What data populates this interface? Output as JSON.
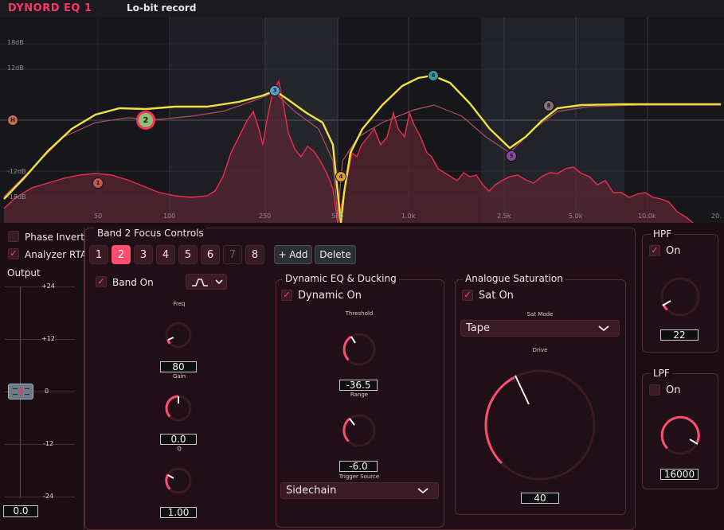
{
  "header": {
    "brand": "DYNORD EQ 1",
    "preset": "Lo-bit record"
  },
  "graph": {
    "db_labels": [
      "18dB",
      "12dB",
      "-12dB",
      "-18dB"
    ],
    "freq_labels": [
      "50",
      "100",
      "250",
      "500",
      "1.0k",
      "2.5k",
      "5.0k",
      "10.0k",
      "20."
    ],
    "nodes": [
      {
        "label": "H",
        "color": "#c96a5a"
      },
      {
        "label": "1",
        "color": "#c05a50"
      },
      {
        "label": "2",
        "color": "#8fbf7a"
      },
      {
        "label": "3",
        "color": "#5a9ec8"
      },
      {
        "label": "4",
        "color": "#e0a030"
      },
      {
        "label": "6",
        "color": "#3a9a9a"
      },
      {
        "label": "5",
        "color": "#8a4aa0"
      },
      {
        "label": "8",
        "color": "#8a7070"
      }
    ]
  },
  "left": {
    "phase_invert": "Phase Invert",
    "analyzer_rta": "Analyzer RTA",
    "output_label": "Output",
    "ticks": [
      "+24",
      "+12",
      "0",
      "-12",
      "-24"
    ],
    "output_value": "0.0"
  },
  "band": {
    "title": "Band 2 Focus Controls",
    "buttons": [
      "1",
      "2",
      "3",
      "4",
      "5",
      "6",
      "7",
      "8"
    ],
    "add_label": "+ Add",
    "delete_label": "Delete",
    "band_on": "Band On",
    "freq_label": "Freq",
    "freq_value": "80",
    "gain_label": "Gain",
    "gain_value": "0.0",
    "q_label": "Q",
    "q_value": "1.00"
  },
  "dynamic": {
    "title": "Dynamic EQ & Ducking",
    "dynamic_on": "Dynamic On",
    "threshold_label": "Threshold",
    "threshold_value": "-36.5",
    "range_label": "Range",
    "range_value": "-6.0",
    "trigger_label": "Trigger Source",
    "trigger_value": "Sidechain"
  },
  "saturation": {
    "title": "Analogue Saturation",
    "sat_on": "Sat On",
    "mode_label": "Sat Mode",
    "mode_value": "Tape",
    "drive_label": "Drive",
    "drive_value": "40"
  },
  "hpf": {
    "title": "HPF",
    "on_label": "On",
    "value": "22"
  },
  "lpf": {
    "title": "LPF",
    "on_label": "On",
    "value": "16000"
  },
  "colors": {
    "accent": "#ff4d70",
    "curve": "#f0e040",
    "brand": "#ff3366"
  }
}
